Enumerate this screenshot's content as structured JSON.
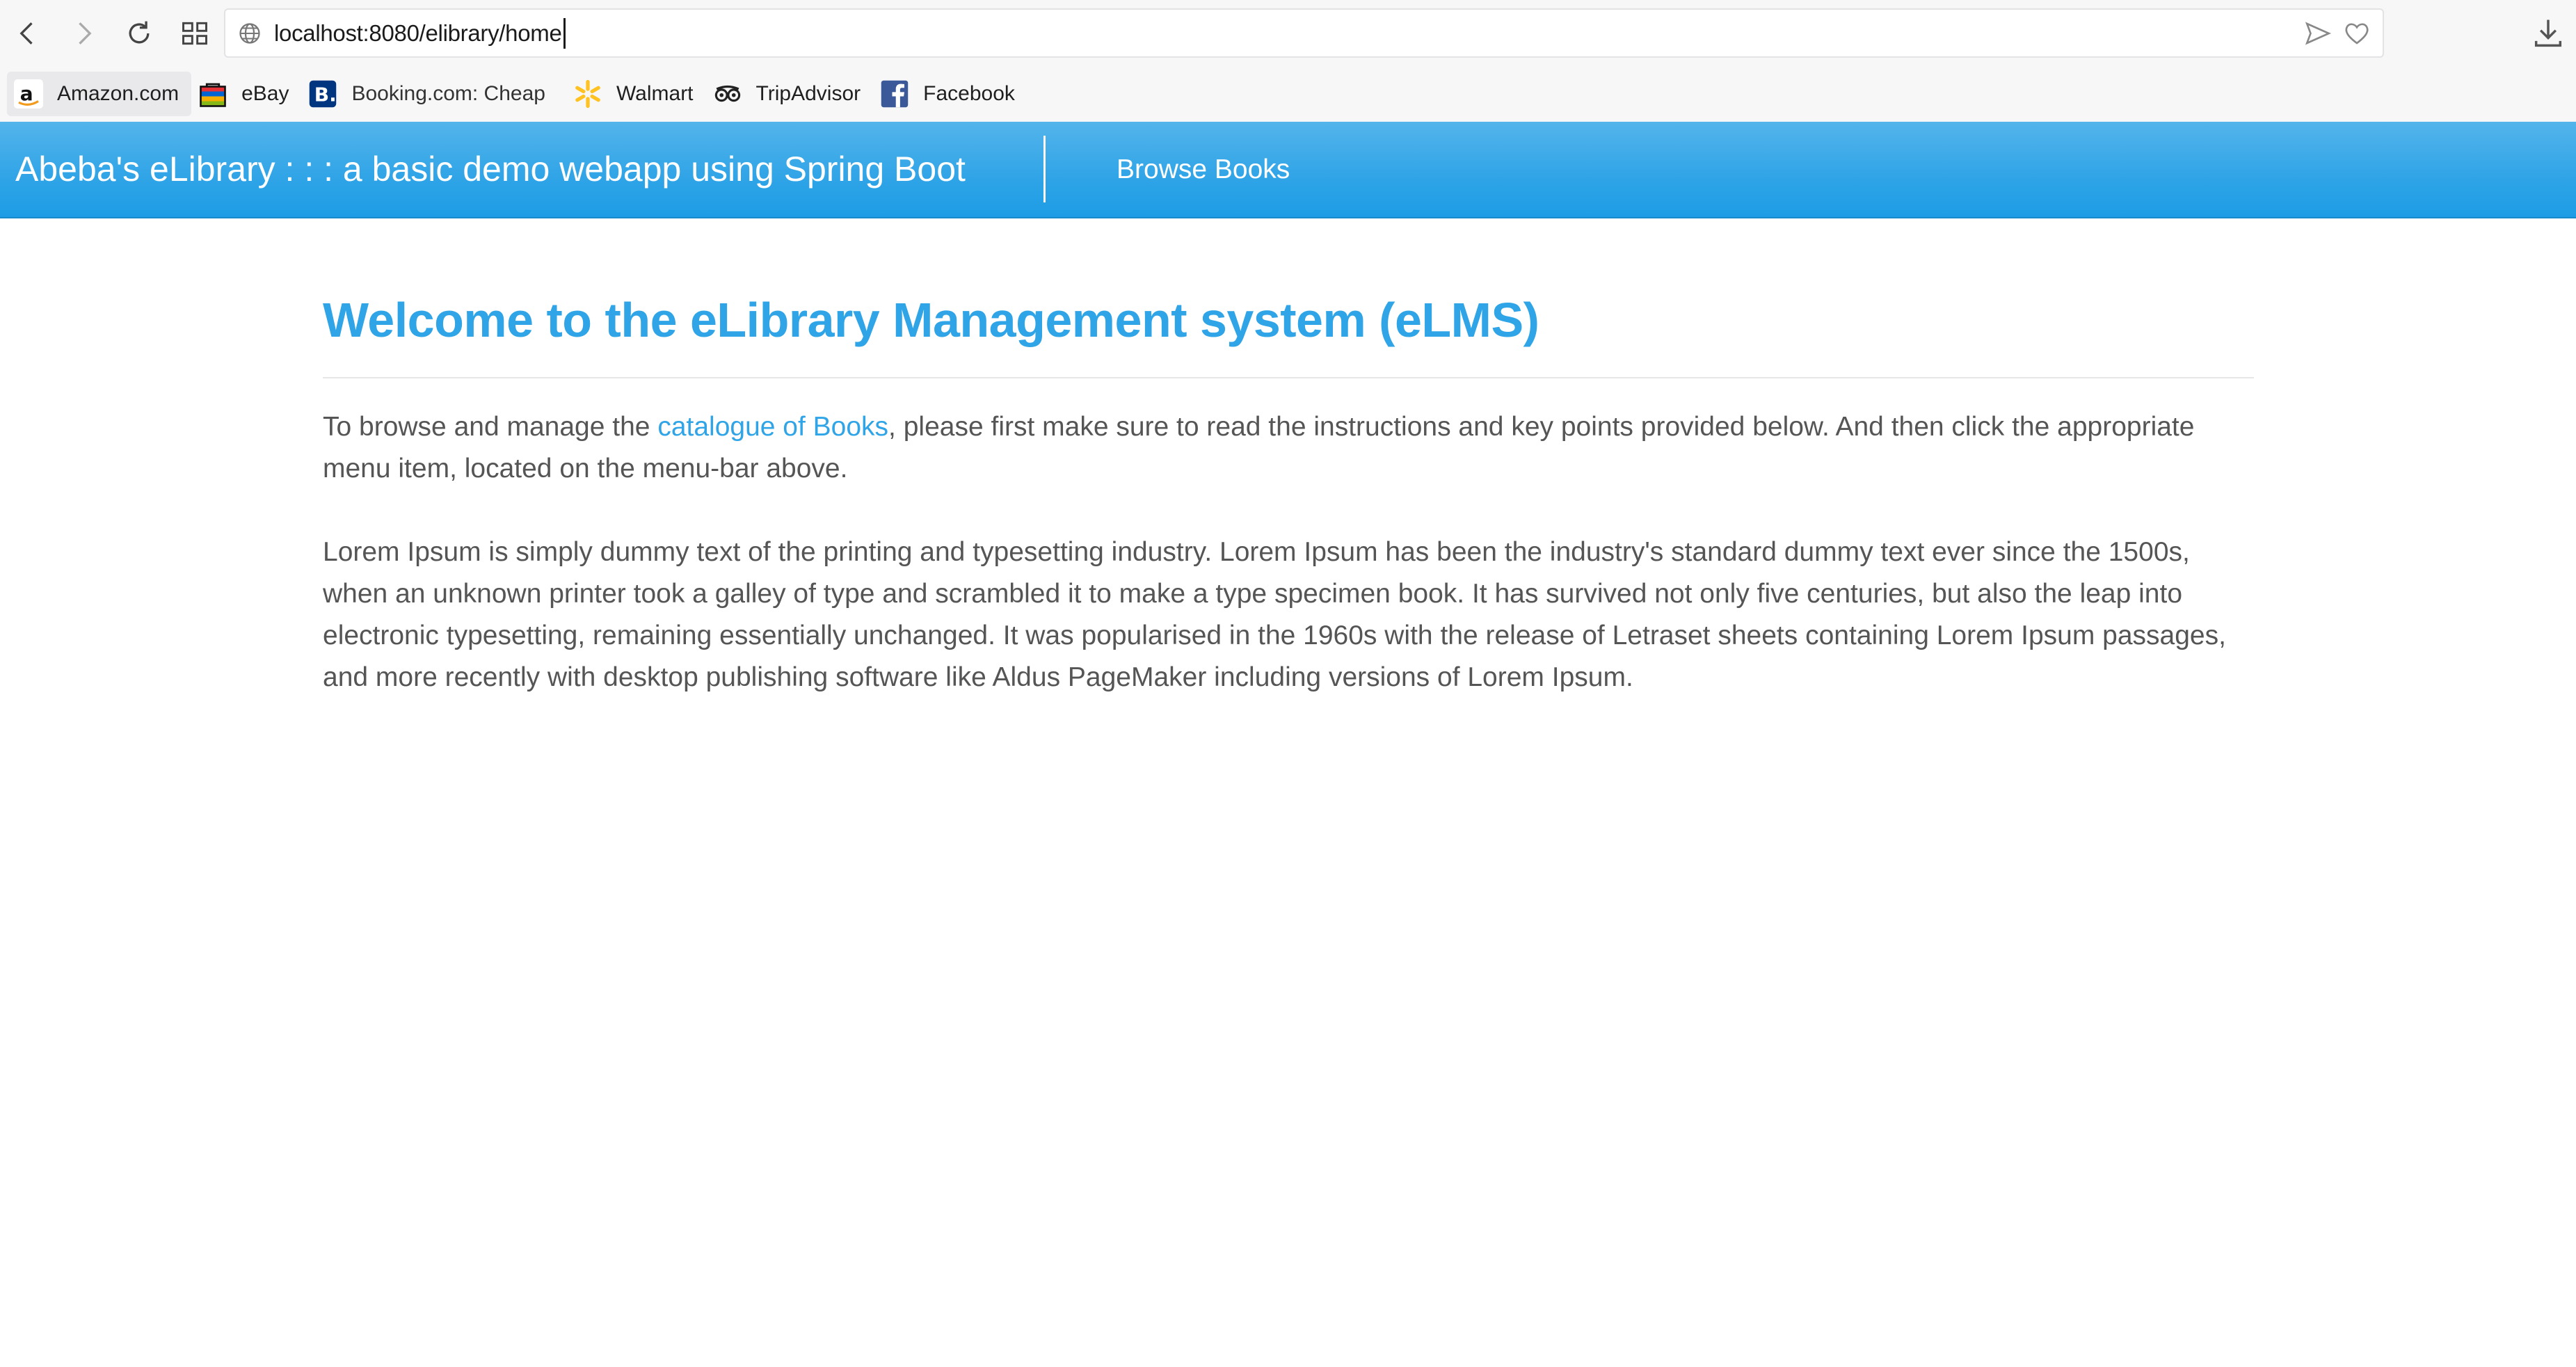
{
  "browser": {
    "url": "localhost:8080/elibrary/home",
    "nav_icons": [
      "back-icon",
      "forward-icon",
      "reload-icon",
      "tabs-grid-icon"
    ],
    "address_icons": [
      "globe-icon",
      "send-icon",
      "heart-icon"
    ],
    "download_icon": "download-icon"
  },
  "bookmarks": [
    {
      "label": "Amazon.com",
      "icon": "amazon-icon"
    },
    {
      "label": "eBay",
      "icon": "ebay-icon"
    },
    {
      "label": "Booking.com: Cheap",
      "icon": "booking-icon"
    },
    {
      "label": "Walmart",
      "icon": "walmart-icon"
    },
    {
      "label": "TripAdvisor",
      "icon": "tripadvisor-icon"
    },
    {
      "label": "Facebook",
      "icon": "facebook-icon"
    }
  ],
  "navbar": {
    "brand": "Abeba's eLibrary : : : a basic demo webapp using Spring Boot",
    "link_browse": "Browse Books",
    "color": "#2fa4e7"
  },
  "main": {
    "heading": "Welcome to the eLibrary Management system (eLMS)",
    "intro_before": "To browse and manage the ",
    "intro_link": "catalogue of Books",
    "intro_after": ", please first make sure to read the instructions and key points provided below. And then click the appropriate menu item, located on the menu-bar above.",
    "lorem": "Lorem Ipsum is simply dummy text of the printing and typesetting industry. Lorem Ipsum has been the industry's standard dummy text ever since the 1500s, when an unknown printer took a galley of type and scrambled it to make a type specimen book. It has survived not only five centuries, but also the leap into electronic typesetting, remaining essentially unchanged. It was popularised in the 1960s with the release of Letraset sheets containing Lorem Ipsum passages, and more recently with desktop publishing software like Aldus PageMaker including versions of Lorem Ipsum."
  }
}
